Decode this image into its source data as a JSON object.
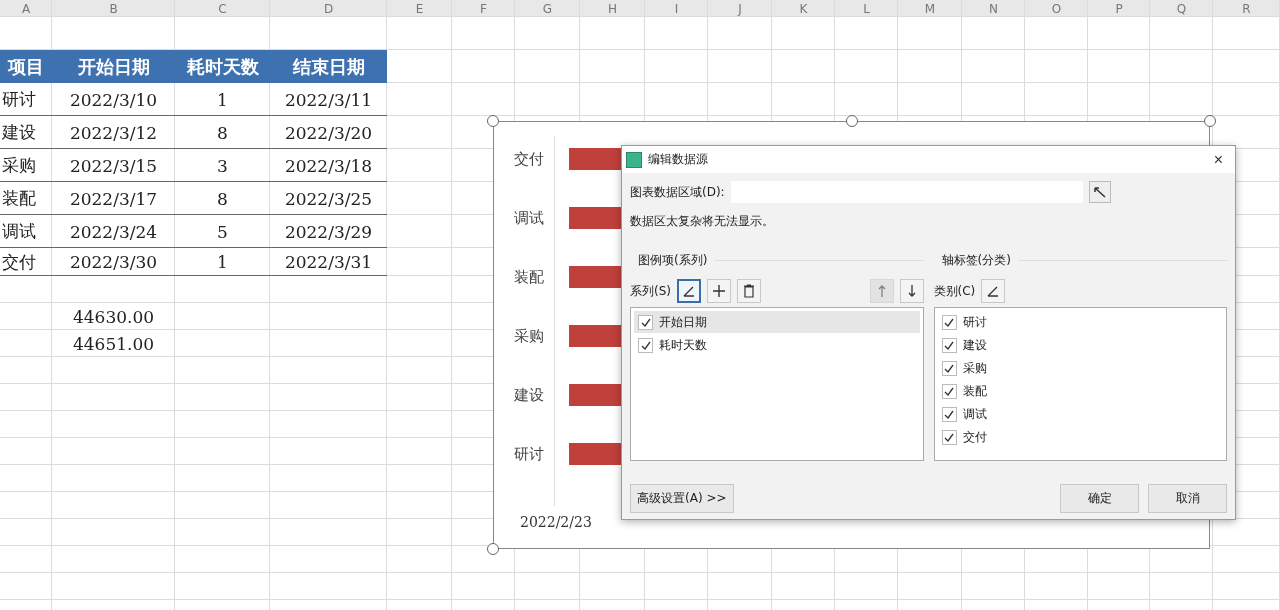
{
  "columns": [
    "A",
    "B",
    "C",
    "D",
    "E",
    "F",
    "G",
    "H",
    "I",
    "J",
    "K",
    "L",
    "M",
    "N",
    "O",
    "P",
    "Q",
    "R"
  ],
  "table": {
    "header": [
      "项目",
      "开始日期",
      "耗时天数",
      "结束日期"
    ],
    "rows": [
      [
        "研讨",
        "2022/3/10",
        "1",
        "2022/3/11"
      ],
      [
        "建设",
        "2022/3/12",
        "8",
        "2022/3/20"
      ],
      [
        "采购",
        "2022/3/15",
        "3",
        "2022/3/18"
      ],
      [
        "装配",
        "2022/3/17",
        "8",
        "2022/3/25"
      ],
      [
        "调试",
        "2022/3/24",
        "5",
        "2022/3/29"
      ],
      [
        "交付",
        "2022/3/30",
        "1",
        "2022/3/31"
      ]
    ]
  },
  "extra_cells": [
    "44630.00",
    "44651.00"
  ],
  "chart": {
    "categories": [
      "交付",
      "调试",
      "装配",
      "采购",
      "建设",
      "研讨"
    ],
    "axis_label": "2022/2/23"
  },
  "dialog": {
    "title": "编辑数据源",
    "close": "×",
    "range_label": "图表数据区域(D):",
    "note": "数据区太复杂将无法显示。",
    "series_group": "图例项(系列)",
    "category_group": "轴标签(分类)",
    "series_label": "系列(S)",
    "category_label": "类别(C)",
    "series_tools": [
      {
        "kind": "edit",
        "disabled": false
      },
      {
        "kind": "add",
        "disabled": false
      },
      {
        "kind": "delete",
        "disabled": false
      },
      {
        "kind": "up",
        "disabled": true
      },
      {
        "kind": "down",
        "disabled": false
      }
    ],
    "series": [
      {
        "label": "开始日期",
        "checked": true,
        "selected": true
      },
      {
        "label": "耗时天数",
        "checked": true,
        "selected": false
      }
    ],
    "categories": [
      {
        "label": "研讨",
        "checked": true
      },
      {
        "label": "建设",
        "checked": true
      },
      {
        "label": "采购",
        "checked": true
      },
      {
        "label": "装配",
        "checked": true
      },
      {
        "label": "调试",
        "checked": true
      },
      {
        "label": "交付",
        "checked": true
      }
    ],
    "advanced_button": "高级设置(A) >>",
    "ok_button": "确定",
    "cancel_button": "取消"
  }
}
